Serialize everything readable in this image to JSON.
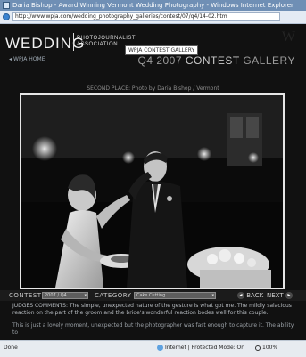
{
  "window": {
    "title": "Daria Bishop - Award Winning Vermont Wedding Photography - Windows Internet Explorer",
    "url": "http://www.wpja.com/wedding_photography_galleries/contest/07/q4/14-02.htm"
  },
  "header": {
    "brand": "WEDDING",
    "brand_sub_line1": "PHOTOJOURNALIST",
    "brand_sub_line2": "ASSOCIATION",
    "home_label": "WPJA HOME",
    "gallery_tab": "WPJA CONTEST GALLERY",
    "gallery_title_prefix": "Q4 2007",
    "gallery_title_mid": "CONTEST",
    "gallery_title_suffix": "GALLERY"
  },
  "photo": {
    "caption": "SECOND PLACE: Photo by Daria Bishop / Vermont"
  },
  "toolbar": {
    "contest_label": "CONTEST",
    "contest_value": "2007 / Q4",
    "category_label": "CATEGORY",
    "category_value": "Cake Cutting",
    "back_label": "BACK",
    "next_label": "NEXT"
  },
  "comments": {
    "paragraph1": "JUDGES COMMENTS: The simple, unexpected nature of the gesture is what got me. The mildly salacious reaction on the part of the groom and the bride's wonderful reaction bodes well for this couple.",
    "paragraph2": "This is just a lovely moment, unexpected but the photographer was fast enough to capture it. The ability to"
  },
  "status": {
    "done": "Done",
    "zone": "Internet | Protected Mode: On",
    "zoom": "100%"
  },
  "colors": {
    "titlebar": "#6f8fb5",
    "page_bg": "#111111",
    "frame": "#e6e6e6"
  }
}
